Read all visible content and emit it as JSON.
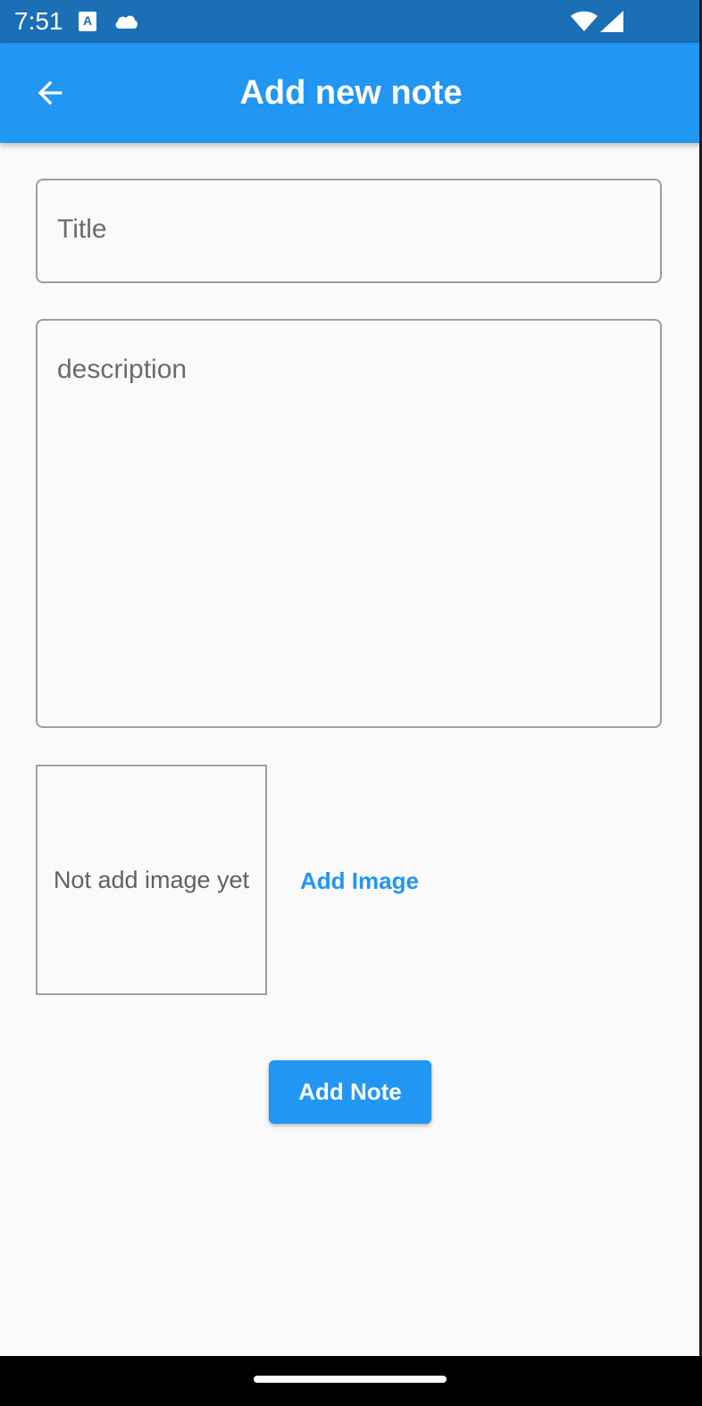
{
  "status_bar": {
    "time": "7:51",
    "a_icon_letter": "A",
    "icons": [
      "a-icon",
      "cloud-icon",
      "wifi-icon",
      "signal-icon"
    ]
  },
  "app_bar": {
    "title": "Add new note",
    "back_icon": "arrow-left-icon",
    "color": "#2196f3"
  },
  "form": {
    "title_placeholder": "Title",
    "description_placeholder": "description"
  },
  "image": {
    "empty_text": "Not add image yet",
    "add_image_label": "Add Image"
  },
  "actions": {
    "add_note_label": "Add Note"
  },
  "colors": {
    "accent": "#2196f3",
    "status_bar": "#1a6fb5",
    "background": "#fafafa"
  }
}
